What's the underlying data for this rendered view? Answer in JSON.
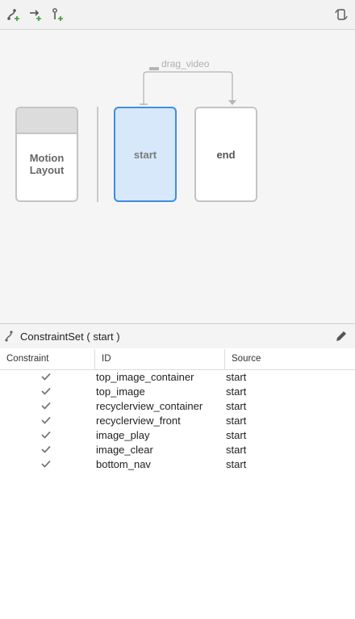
{
  "toolbar": {
    "create_constraintset_icon": "create-constraintset-icon",
    "create_transition_icon": "create-transition-icon",
    "create_onclick_icon": "create-onclick-icon",
    "cycle_layout_icon": "cycle-layout-icon"
  },
  "graph": {
    "motion_layout_label_line1": "Motion",
    "motion_layout_label_line2": "Layout",
    "start_label": "start",
    "end_label": "end",
    "transition_label": "drag_video",
    "selected_color": "#3d8ee0"
  },
  "constraintset": {
    "title": "ConstraintSet ( start )",
    "columns": [
      "Constraint",
      "ID",
      "Source"
    ],
    "rows": [
      {
        "id": "top_image_container",
        "source": "start"
      },
      {
        "id": "top_image",
        "source": "start"
      },
      {
        "id": "recyclerview_container",
        "source": "start"
      },
      {
        "id": "recyclerview_front",
        "source": "start"
      },
      {
        "id": "image_play",
        "source": "start"
      },
      {
        "id": "image_clear",
        "source": "start"
      },
      {
        "id": "bottom_nav",
        "source": "start"
      }
    ]
  }
}
